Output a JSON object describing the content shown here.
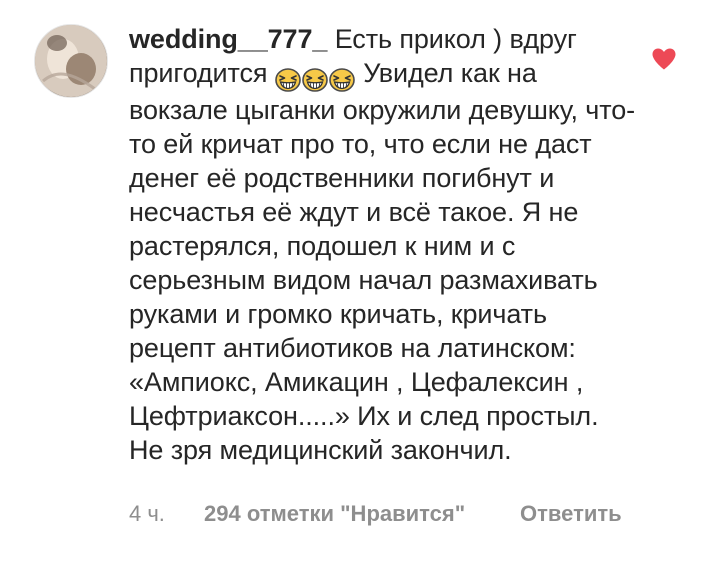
{
  "comment": {
    "username": "wedding__777_",
    "text_start": "Есть прикол ) вдруг пригодится",
    "emoji_name": "grinning-squinting-face-icon",
    "emoji_count": 3,
    "text_rest": "Увидел как на вокзале цыганки окружили девушку, что-то ей кричат про то, что если не даст денег её родственники погибнут и несчастья её ждут и всё такое. Я не растерялся, подошел к ним и с серьезным видом начал размахивать руками и громко кричать, кричать рецепт антибиотиков на латинском: «Ампиокс, Амикацин , Цефалексин , Цефтриаксон.....» Их и след простыл. Не зря медицинский закончил.",
    "time": "4 ч.",
    "likes": "294 отметки \"Нравится\"",
    "reply_label": "Ответить",
    "liked": true,
    "heart_color": "#ed4956"
  },
  "colors": {
    "text": "#262626",
    "meta": "#8e8e8e",
    "emoji_face": "#f7c948"
  },
  "icons": {
    "avatar": "user-avatar",
    "like": "heart-icon"
  }
}
